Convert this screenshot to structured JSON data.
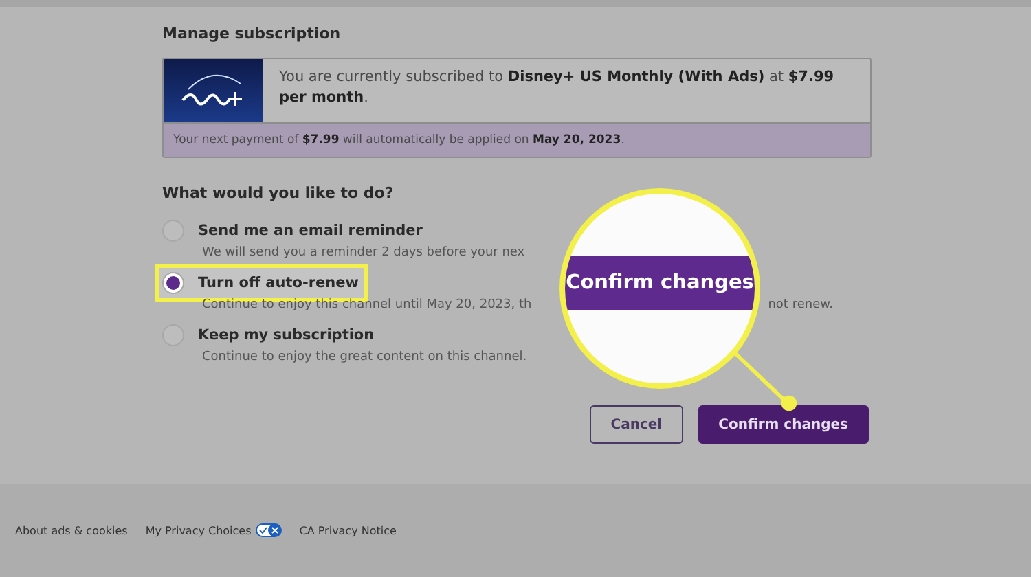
{
  "section_title": "Manage subscription",
  "subscription": {
    "text": "You are currently subscribed to **Disney+ US Monthly (With Ads)** at **$7.99 per month**.",
    "payment_note": "Your next payment of **$7.99** will automatically be applied on **May 20, 2023**."
  },
  "question": "What would you like to do?",
  "options": [
    {
      "label": "Send me an email reminder",
      "description": "We will send you a reminder 2 days before your nex",
      "selected": false,
      "highlighted": false
    },
    {
      "label": "Turn off auto-renew",
      "description": "Continue to enjoy this channel until May 20, 2023, th",
      "description_tail": "not renew.",
      "selected": true,
      "highlighted": true
    },
    {
      "label": "Keep my subscription",
      "description": "Continue to enjoy the great content on this channel.",
      "selected": false,
      "highlighted": false
    }
  ],
  "buttons": [
    {
      "label": "Cancel",
      "kind": "secondary"
    },
    {
      "label": "Confirm changes",
      "kind": "primary"
    }
  ],
  "callout": {
    "label": "Confirm changes"
  },
  "footer_links": [
    {
      "label": "About ads & cookies",
      "badge": false
    },
    {
      "label": "My Privacy Choices",
      "badge": true
    },
    {
      "label": "CA Privacy Notice",
      "badge": false
    }
  ]
}
